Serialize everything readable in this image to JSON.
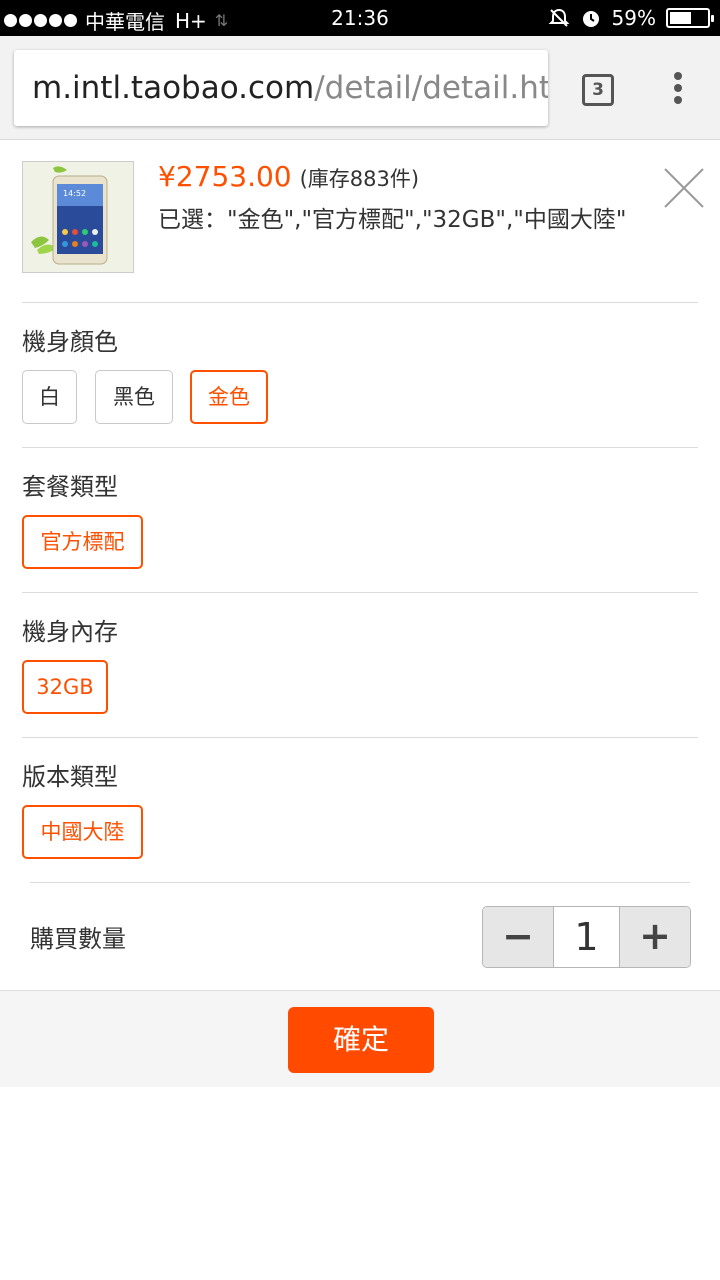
{
  "status_bar": {
    "carrier": "中華電信",
    "network": "H+",
    "time": "21:36",
    "battery": "59%",
    "battery_level": 0.59
  },
  "browser": {
    "url_host": "m.intl.taobao.com",
    "url_path": "/detail/detail.htm",
    "tab_count": "3"
  },
  "product": {
    "price": "¥2753.00",
    "stock": "(庫存883件)",
    "selected": "已選：\"金色\",\"官方標配\",\"32GB\",\"中國大陸\""
  },
  "sections": {
    "color": {
      "title": "機身顏色",
      "options": [
        "白",
        "黑色",
        "金色"
      ],
      "selected": "金色"
    },
    "package": {
      "title": "套餐類型",
      "options": [
        "官方標配"
      ],
      "selected": "官方標配"
    },
    "storage": {
      "title": "機身內存",
      "options": [
        "32GB"
      ],
      "selected": "32GB"
    },
    "version": {
      "title": "版本類型",
      "options": [
        "中國大陸"
      ],
      "selected": "中國大陸"
    }
  },
  "quantity": {
    "label": "購買數量",
    "minus": "−",
    "value": "1",
    "plus": "+"
  },
  "confirm_label": "確定",
  "colors": {
    "accent": "#ff5000",
    "confirm_bg": "#ff4a00"
  }
}
